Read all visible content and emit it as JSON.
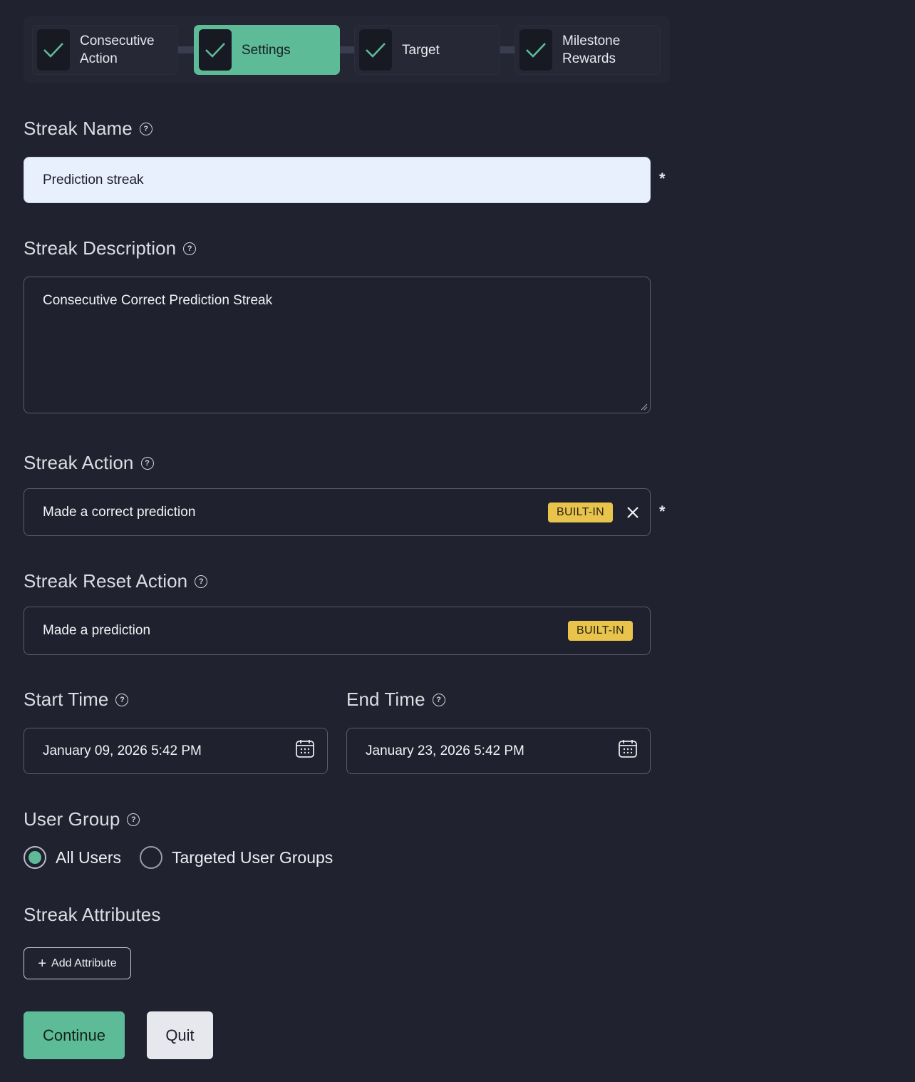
{
  "stepper": {
    "steps": [
      {
        "label_line1": "Consecutive",
        "label_line2": "Action"
      },
      {
        "label_line1": "Settings",
        "label_line2": ""
      },
      {
        "label_line1": "Target",
        "label_line2": ""
      },
      {
        "label_line1": "Milestone",
        "label_line2": "Rewards"
      }
    ],
    "active_index": 1
  },
  "streak_name": {
    "label": "Streak Name",
    "value": "Prediction streak",
    "required_mark": "*"
  },
  "streak_description": {
    "label": "Streak Description",
    "value": "Consecutive Correct Prediction Streak"
  },
  "streak_action": {
    "label": "Streak Action",
    "value": "Made a correct prediction",
    "badge": "BUILT-IN",
    "required_mark": "*"
  },
  "streak_reset_action": {
    "label": "Streak Reset Action",
    "value": "Made a prediction",
    "badge": "BUILT-IN"
  },
  "start_time": {
    "label": "Start Time",
    "value": "January 09, 2026 5:42 PM"
  },
  "end_time": {
    "label": "End Time",
    "value": "January 23, 2026 5:42 PM"
  },
  "user_group": {
    "label": "User Group",
    "options": [
      "All Users",
      "Targeted User Groups"
    ],
    "selected": "All Users"
  },
  "streak_attributes": {
    "label": "Streak Attributes",
    "add_button": "Add Attribute"
  },
  "actions": {
    "continue": "Continue",
    "quit": "Quit"
  },
  "colors": {
    "accent": "#5dbb97",
    "badge": "#e8c44d",
    "background": "#20222f"
  },
  "help_glyph": "?"
}
